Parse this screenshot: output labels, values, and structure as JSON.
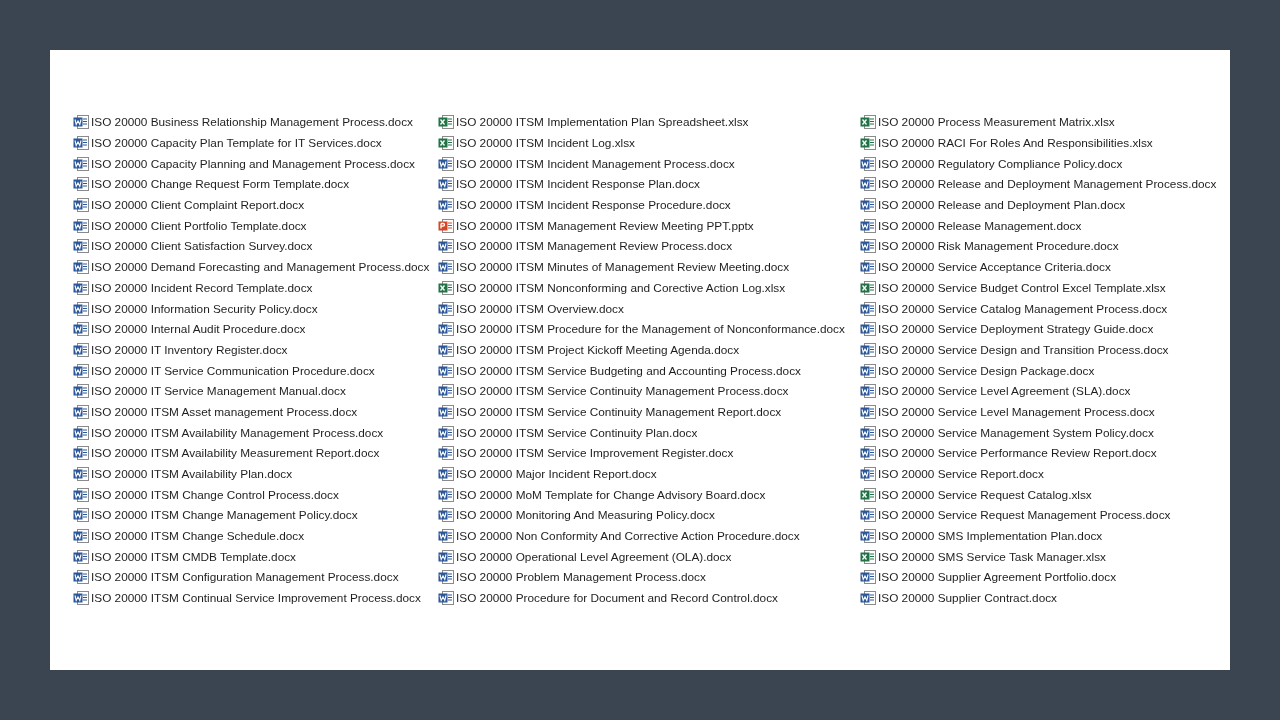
{
  "columns": [
    {
      "files": [
        {
          "name": "ISO 20000 Business Relationship Management Process.docx",
          "kind": "docx"
        },
        {
          "name": "ISO 20000 Capacity Plan Template for IT Services.docx",
          "kind": "docx"
        },
        {
          "name": "ISO 20000 Capacity Planning and Management Process.docx",
          "kind": "docx"
        },
        {
          "name": "ISO 20000 Change Request Form Template.docx",
          "kind": "docx"
        },
        {
          "name": "ISO 20000 Client Complaint Report.docx",
          "kind": "docx"
        },
        {
          "name": "ISO 20000 Client Portfolio Template.docx",
          "kind": "docx"
        },
        {
          "name": "ISO 20000 Client Satisfaction Survey.docx",
          "kind": "docx"
        },
        {
          "name": "ISO 20000 Demand Forecasting and Management Process.docx",
          "kind": "docx"
        },
        {
          "name": "ISO 20000 Incident Record Template.docx",
          "kind": "docx"
        },
        {
          "name": "ISO 20000 Information Security Policy.docx",
          "kind": "docx"
        },
        {
          "name": "ISO 20000 Internal Audit Procedure.docx",
          "kind": "docx"
        },
        {
          "name": "ISO 20000 IT Inventory Register.docx",
          "kind": "docx"
        },
        {
          "name": "ISO 20000 IT Service Communication Procedure.docx",
          "kind": "docx"
        },
        {
          "name": "ISO 20000 IT Service Management Manual.docx",
          "kind": "docx"
        },
        {
          "name": "ISO 20000 ITSM Asset management Process.docx",
          "kind": "docx"
        },
        {
          "name": "ISO 20000 ITSM Availability Management Process.docx",
          "kind": "docx"
        },
        {
          "name": "ISO 20000 ITSM Availability Measurement Report.docx",
          "kind": "docx"
        },
        {
          "name": "ISO 20000 ITSM Availability Plan.docx",
          "kind": "docx"
        },
        {
          "name": "ISO 20000 ITSM Change Control Process.docx",
          "kind": "docx"
        },
        {
          "name": "ISO 20000 ITSM Change Management Policy.docx",
          "kind": "docx"
        },
        {
          "name": "ISO 20000 ITSM Change Schedule.docx",
          "kind": "docx"
        },
        {
          "name": "ISO 20000 ITSM CMDB Template.docx",
          "kind": "docx"
        },
        {
          "name": "ISO 20000 ITSM Configuration Management Process.docx",
          "kind": "docx"
        },
        {
          "name": "ISO 20000 ITSM Continual Service Improvement Process.docx",
          "kind": "docx"
        }
      ]
    },
    {
      "files": [
        {
          "name": "ISO 20000 ITSM Implementation Plan Spreadsheet.xlsx",
          "kind": "xlsx"
        },
        {
          "name": "ISO 20000 ITSM Incident Log.xlsx",
          "kind": "xlsx"
        },
        {
          "name": "ISO 20000 ITSM Incident Management Process.docx",
          "kind": "docx"
        },
        {
          "name": "ISO 20000 ITSM Incident Response Plan.docx",
          "kind": "docx"
        },
        {
          "name": "ISO 20000 ITSM Incident Response Procedure.docx",
          "kind": "docx"
        },
        {
          "name": "ISO 20000 ITSM Management Review Meeting PPT.pptx",
          "kind": "pptx"
        },
        {
          "name": "ISO 20000 ITSM Management Review Process.docx",
          "kind": "docx"
        },
        {
          "name": "ISO 20000 ITSM Minutes of Management Review Meeting.docx",
          "kind": "docx"
        },
        {
          "name": "ISO 20000 ITSM Nonconforming and Corective Action Log.xlsx",
          "kind": "xlsx"
        },
        {
          "name": "ISO 20000 ITSM Overview.docx",
          "kind": "docx"
        },
        {
          "name": "ISO 20000 ITSM Procedure for the Management of Nonconformance.docx",
          "kind": "docx"
        },
        {
          "name": "ISO 20000 ITSM Project Kickoff Meeting Agenda.docx",
          "kind": "docx"
        },
        {
          "name": "ISO 20000 ITSM Service Budgeting and Accounting Process.docx",
          "kind": "docx"
        },
        {
          "name": "ISO 20000 ITSM Service Continuity Management Process.docx",
          "kind": "docx"
        },
        {
          "name": "ISO 20000 ITSM Service Continuity Management Report.docx",
          "kind": "docx"
        },
        {
          "name": "ISO 20000 ITSM Service Continuity Plan.docx",
          "kind": "docx"
        },
        {
          "name": "ISO 20000 ITSM Service Improvement Register.docx",
          "kind": "docx"
        },
        {
          "name": "ISO 20000 Major Incident Report.docx",
          "kind": "docx"
        },
        {
          "name": "ISO 20000 MoM Template for Change Advisory Board.docx",
          "kind": "docx"
        },
        {
          "name": "ISO 20000 Monitoring And Measuring Policy.docx",
          "kind": "docx"
        },
        {
          "name": "ISO 20000 Non Conformity And Corrective Action Procedure.docx",
          "kind": "docx"
        },
        {
          "name": "ISO 20000 Operational Level Agreement (OLA).docx",
          "kind": "docx"
        },
        {
          "name": "ISO 20000 Problem Management Process.docx",
          "kind": "docx"
        },
        {
          "name": "ISO 20000 Procedure for Document and Record Control.docx",
          "kind": "docx"
        }
      ]
    },
    {
      "files": [
        {
          "name": "ISO 20000 Process Measurement Matrix.xlsx",
          "kind": "xlsx"
        },
        {
          "name": "ISO 20000 RACI For Roles And Responsibilities.xlsx",
          "kind": "xlsx"
        },
        {
          "name": "ISO 20000 Regulatory Compliance Policy.docx",
          "kind": "docx"
        },
        {
          "name": "ISO 20000 Release and Deployment Management Process.docx",
          "kind": "docx"
        },
        {
          "name": "ISO 20000 Release and Deployment Plan.docx",
          "kind": "docx"
        },
        {
          "name": "ISO 20000 Release Management.docx",
          "kind": "docx"
        },
        {
          "name": "ISO 20000 Risk Management Procedure.docx",
          "kind": "docx"
        },
        {
          "name": "ISO 20000 Service Acceptance Criteria.docx",
          "kind": "docx"
        },
        {
          "name": "ISO 20000 Service Budget Control Excel Template.xlsx",
          "kind": "xlsx"
        },
        {
          "name": "ISO 20000 Service Catalog Management Process.docx",
          "kind": "docx"
        },
        {
          "name": "ISO 20000 Service Deployment Strategy Guide.docx",
          "kind": "docx"
        },
        {
          "name": "ISO 20000 Service Design and Transition Process.docx",
          "kind": "docx"
        },
        {
          "name": "ISO 20000 Service Design Package.docx",
          "kind": "docx"
        },
        {
          "name": "ISO 20000 Service Level Agreement (SLA).docx",
          "kind": "docx"
        },
        {
          "name": "ISO 20000 Service Level Management Process.docx",
          "kind": "docx"
        },
        {
          "name": "ISO 20000 Service Management System Policy.docx",
          "kind": "docx"
        },
        {
          "name": "ISO 20000 Service Performance Review Report.docx",
          "kind": "docx"
        },
        {
          "name": "ISO 20000 Service Report.docx",
          "kind": "docx"
        },
        {
          "name": "ISO 20000 Service Request Catalog.xlsx",
          "kind": "xlsx"
        },
        {
          "name": "ISO 20000 Service Request Management Process.docx",
          "kind": "docx"
        },
        {
          "name": "ISO 20000 SMS Implementation Plan.docx",
          "kind": "docx"
        },
        {
          "name": "ISO 20000 SMS Service Task Manager.xlsx",
          "kind": "xlsx"
        },
        {
          "name": "ISO 20000 Supplier Agreement Portfolio.docx",
          "kind": "docx"
        },
        {
          "name": "ISO 20000 Supplier Contract.docx",
          "kind": "docx"
        }
      ]
    }
  ]
}
